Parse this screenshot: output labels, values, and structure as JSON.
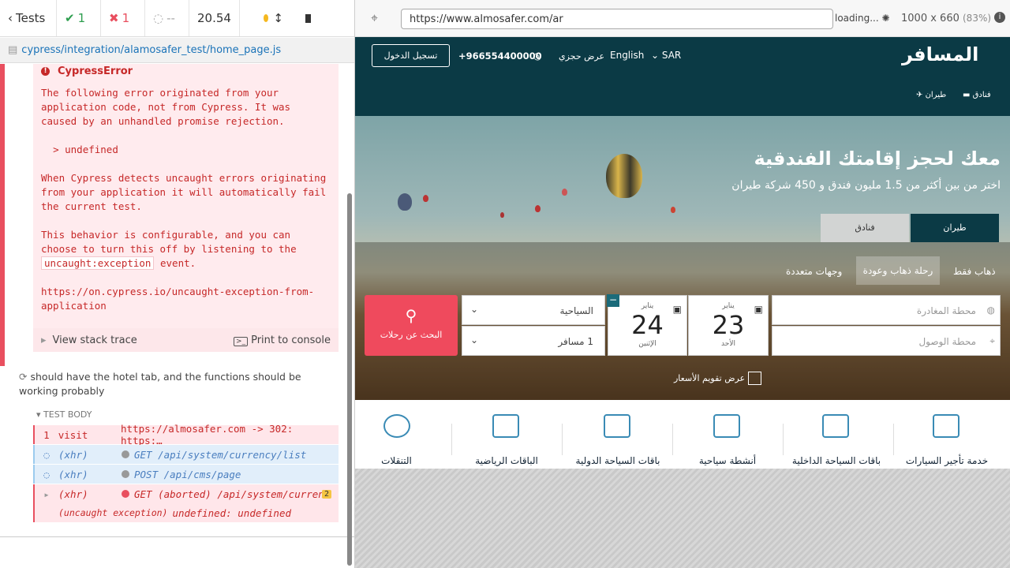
{
  "runner": {
    "tests_label": "Tests",
    "passed": "1",
    "failed": "1",
    "pending": "--",
    "duration": "20.54",
    "file": "cypress/integration/alamosafer_test/home_page.js",
    "error_title": "CypressError",
    "error_text": "The following error originated from your application code, not from Cypress. It was caused by an unhandled promise rejection.\n\n  > undefined\n\nWhen Cypress detects uncaught errors originating from your application it will automatically fail the current test.\n\nThis behavior is configurable, and you can choose to turn this off by listening to the ",
    "error_code": "uncaught:exception",
    "error_after": " event.\n\nhttps://on.cypress.io/uncaught-exception-from-application",
    "view_stack": "View stack trace",
    "print_console": "Print to console",
    "test_title": "should have the hotel tab, and the functions should be working probably",
    "test_body": "TEST BODY",
    "commands": [
      {
        "n": "1",
        "type": "visit",
        "msg": "https://almosafer.com -> 302: https:…"
      },
      {
        "n": "",
        "type": "(xhr)",
        "msg": "GET /api/system/currency/list"
      },
      {
        "n": "",
        "type": "(xhr)",
        "msg": "POST /api/cms/page"
      },
      {
        "n": "",
        "type": "(xhr)",
        "msg": "GET (aborted) /api/system/curren…"
      },
      {
        "n": "",
        "type": "(uncaught exception)",
        "msg": "undefined: undefined"
      }
    ],
    "badge": "2"
  },
  "browser": {
    "url": "https://www.almosafer.com/ar",
    "loading": "loading...",
    "viewport": "1000 x 660",
    "scale": "(83%)"
  },
  "site": {
    "login": "تسجيل الدخول",
    "phone": "+966554400000",
    "my_booking": "عرض حجزي",
    "language": "English",
    "currency": "SAR",
    "logo": "المسافر",
    "nav_flights": "طيران",
    "nav_hotels": "فنادق",
    "hero_title": "معك لحجز إقامتك الفندقية",
    "hero_sub": "اختر من بين أكثر من 1.5 مليون فندق و 450 شركة طيران",
    "tab_flights": "طيران",
    "tab_hotels": "فنادق",
    "trip_oneway": "ذهاب فقط",
    "trip_round": "رحلة ذهاب وعودة",
    "trip_multi": "وجهات متعددة",
    "from_placeholder": "محطة المغادرة",
    "to_placeholder": "محطة الوصول",
    "dep_month": "يناير",
    "dep_day": "23",
    "dep_weekday": "الأحد",
    "ret_month": "يناير",
    "ret_day": "24",
    "ret_weekday": "الإثنين",
    "cabin": "السياحية",
    "passengers": "1 مسافر",
    "search": "البحث عن رحلات",
    "fare_calendar": "عرض تقويم الأسعار",
    "categories": [
      "خدمة تأجير السيارات",
      "باقات السياحة الداخلية",
      "أنشطة سياحية",
      "باقات السياحة الدولية",
      "الباقات الرياضية",
      "التنقلات"
    ]
  }
}
